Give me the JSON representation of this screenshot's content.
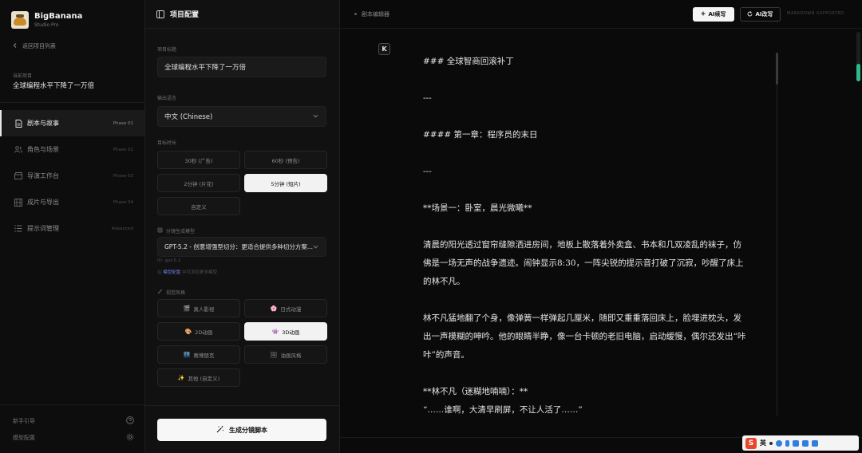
{
  "brand": {
    "name": "BigBanana",
    "subtitle": "Studio Pro"
  },
  "sidebar": {
    "back_label": "返回项目列表",
    "current_project_label": "当前项目",
    "current_project_name": "全球编程水平下降了一万倍",
    "items": [
      {
        "label": "剧本与故事",
        "phase": "Phase 01",
        "icon": "file-icon",
        "active": true
      },
      {
        "label": "角色与场景",
        "phase": "Phase 02",
        "icon": "users-icon",
        "active": false
      },
      {
        "label": "导演工作台",
        "phase": "Phase 03",
        "icon": "clapperboard-icon",
        "active": false
      },
      {
        "label": "成片与导出",
        "phase": "Phase 04",
        "icon": "film-icon",
        "active": false
      },
      {
        "label": "提示词管理",
        "phase": "Advanced",
        "icon": "list-icon",
        "active": false
      }
    ],
    "footer": [
      {
        "label": "新手引导",
        "icon": "help-icon"
      },
      {
        "label": "模型配置",
        "icon": "settings-icon"
      }
    ]
  },
  "config": {
    "title": "项目配置",
    "project_title_label": "项目标题",
    "project_title_value": "全球编程水平下降了一万倍",
    "output_lang_label": "输出语言",
    "output_lang_value": "中文 (Chinese)",
    "duration_label": "目标时长",
    "durations": [
      {
        "label": "30秒 (广告)",
        "selected": false
      },
      {
        "label": "60秒 (预告)",
        "selected": false
      },
      {
        "label": "2分钟 (片花)",
        "selected": false
      },
      {
        "label": "5分钟 (短片)",
        "selected": true
      },
      {
        "label": "自定义",
        "selected": false
      }
    ],
    "model_label": "分镜生成模型",
    "model_value": "GPT-5.2 - 创意增强型切分：更适合提供多种切分方案...",
    "model_id": "ID: gpt-5.2",
    "model_hint_prefix": "在",
    "model_hint_link": "模型配置",
    "model_hint_suffix": "中可添加更多模型",
    "style_label": "视觉风格",
    "styles": [
      {
        "emoji": "🎬",
        "label": "真人影视",
        "selected": false
      },
      {
        "emoji": "🌸",
        "label": "日式动漫",
        "selected": false
      },
      {
        "emoji": "🎨",
        "label": "2D动画",
        "selected": false
      },
      {
        "emoji": "👾",
        "label": "3D动画",
        "selected": true
      },
      {
        "emoji": "🌃",
        "label": "赛博朋克",
        "selected": false
      },
      {
        "emoji": "🖼",
        "label": "油画风格",
        "selected": false
      },
      {
        "emoji": "✨",
        "label": "其他 (自定义)",
        "selected": false
      }
    ],
    "generate_label": "生成分镜脚本"
  },
  "editor": {
    "tab_label": "剧本编辑器",
    "ai_continue_label": "AI续写",
    "ai_rewrite_label": "AI改写",
    "markdown_note": "MARKDOWN SUPPORTED",
    "badge_letter": "K",
    "lines": [
      "### 全球智商回滚补丁",
      "",
      "---",
      "",
      "#### 第一章：程序员的末日",
      "",
      "---",
      "",
      "**场景一：卧室，晨光微曦**",
      "",
      "清晨的阳光透过窗帘缝隙洒进房间，地板上散落着外卖盒、书本和几双凌乱的袜子，仿",
      "佛是一场无声的战争遗迹。闹钟显示8:30，一阵尖锐的提示音打破了沉寂，吵醒了床上",
      "的林不凡。",
      "",
      "林不凡猛地翻了个身，像弹簧一样弹起几厘米，随即又重重落回床上，脸埋进枕头，发",
      "出一声模糊的呻吟。他的眼睛半睁，像一台卡顿的老旧电脑，启动缓慢，偶尔还发出“咔",
      "咔”的声音。",
      "",
      "**林不凡（迷糊地喃喃）：**",
      "“……谁啊，大清早刷屏，不让人活了……”"
    ]
  },
  "ime": {
    "text": "英"
  }
}
